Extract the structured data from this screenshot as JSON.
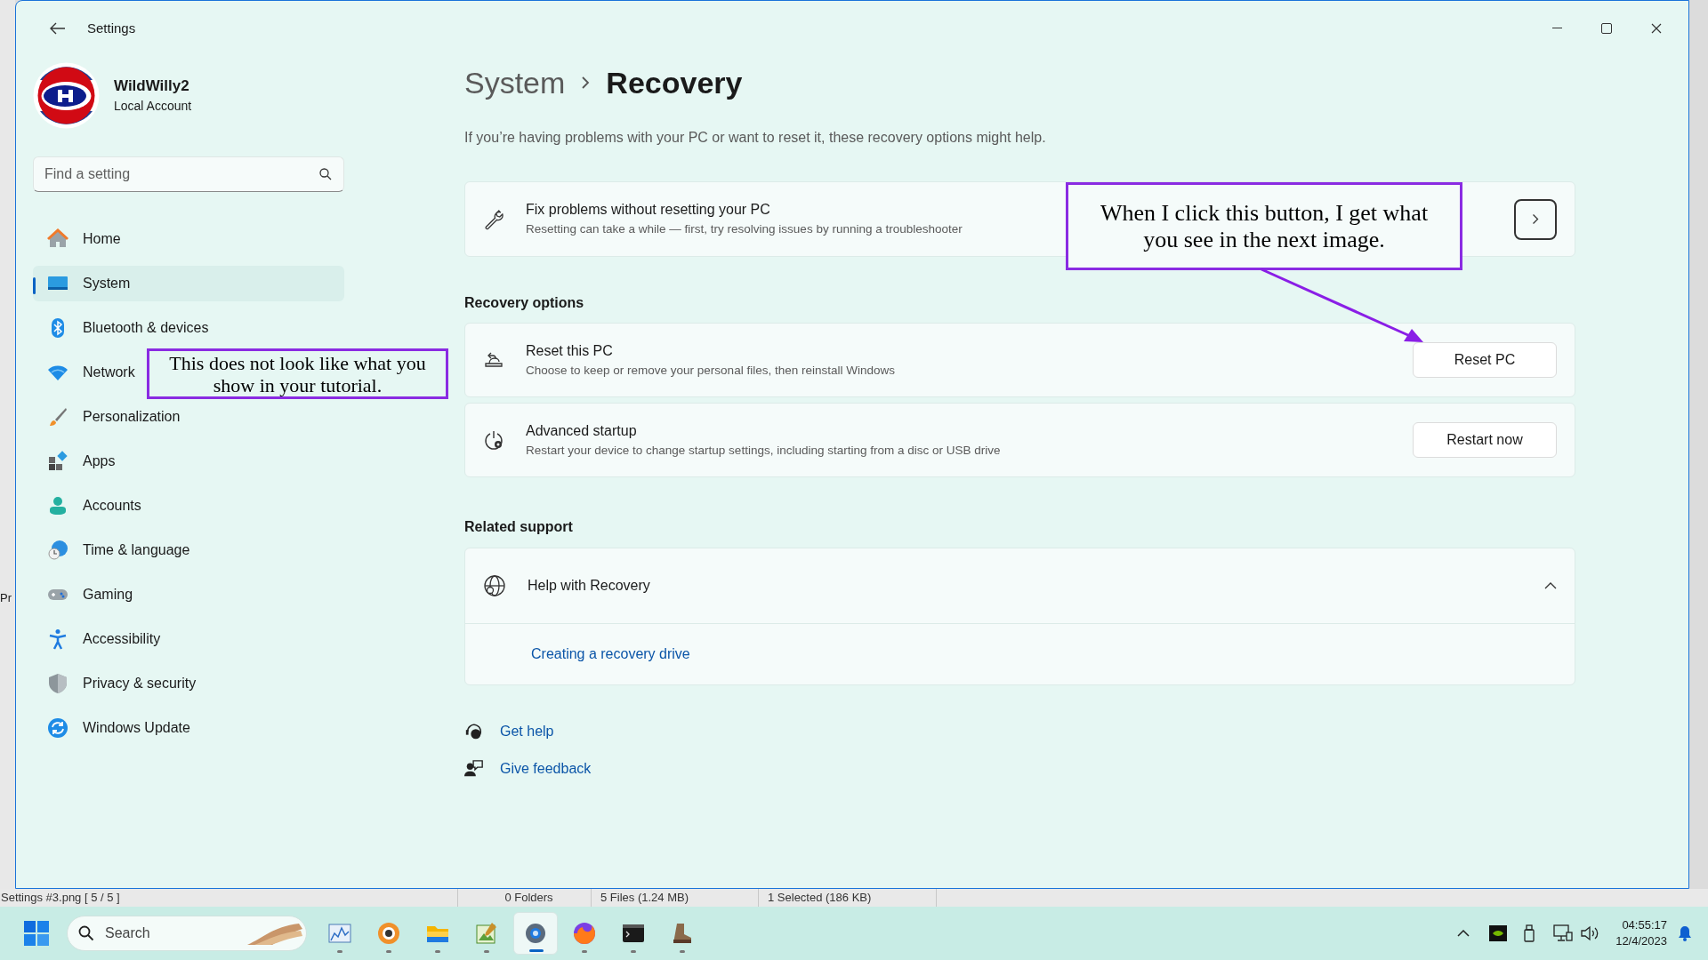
{
  "window": {
    "title": "Settings"
  },
  "profile": {
    "name": "WildWilly2",
    "account_type": "Local Account"
  },
  "search": {
    "placeholder": "Find a setting"
  },
  "sidebar": {
    "items": [
      {
        "kind": "home",
        "label": "Home",
        "selected": false
      },
      {
        "kind": "system",
        "label": "System",
        "selected": true
      },
      {
        "kind": "bluetooth",
        "label": "Bluetooth & devices",
        "selected": false
      },
      {
        "kind": "network",
        "label": "Network",
        "selected": false
      },
      {
        "kind": "personalization",
        "label": "Personalization",
        "selected": false
      },
      {
        "kind": "apps",
        "label": "Apps",
        "selected": false
      },
      {
        "kind": "accounts",
        "label": "Accounts",
        "selected": false
      },
      {
        "kind": "time",
        "label": "Time & language",
        "selected": false
      },
      {
        "kind": "gaming",
        "label": "Gaming",
        "selected": false
      },
      {
        "kind": "accessibility",
        "label": "Accessibility",
        "selected": false
      },
      {
        "kind": "privacy",
        "label": "Privacy & security",
        "selected": false
      },
      {
        "kind": "update",
        "label": "Windows Update",
        "selected": false
      }
    ]
  },
  "breadcrumb": {
    "parent": "System",
    "current": "Recovery"
  },
  "description": "If you’re having problems with your PC or want to reset it, these recovery options might help.",
  "fix_card": {
    "title": "Fix problems without resetting your PC",
    "subtitle": "Resetting can take a while — first, try resolving issues by running a troubleshooter"
  },
  "recovery_options": {
    "heading": "Recovery options",
    "items": [
      {
        "kind": "reset",
        "title": "Reset this PC",
        "subtitle": "Choose to keep or remove your personal files, then reinstall Windows",
        "button": "Reset PC"
      },
      {
        "kind": "startup",
        "title": "Advanced startup",
        "subtitle": "Restart your device to change startup settings, including starting from a disc or USB drive",
        "button": "Restart now"
      }
    ]
  },
  "related_support": {
    "heading": "Related support",
    "help": {
      "title": "Help with Recovery",
      "expanded": true,
      "links": [
        "Creating a recovery drive"
      ]
    }
  },
  "footer_links": [
    {
      "kind": "help",
      "label": "Get help"
    },
    {
      "kind": "feedback",
      "label": "Give feedback"
    }
  ],
  "annotations": [
    {
      "text": "This does not look like what you show in your tutorial."
    },
    {
      "text": "When I click this button, I get what you see in the next image."
    }
  ],
  "background_app": {
    "edge_text": "Pr",
    "status_bar": [
      "Settings #3.png [ 5 / 5 ]",
      "0 Folders",
      "5 Files (1.24 MB)",
      "1 Selected (186 KB)"
    ]
  },
  "taskbar": {
    "search_placeholder": "Search",
    "apps": [
      {
        "kind": "monitor",
        "selected": false
      },
      {
        "kind": "viewer",
        "selected": false
      },
      {
        "kind": "folder",
        "selected": false
      },
      {
        "kind": "editor",
        "selected": false
      },
      {
        "kind": "settings",
        "selected": true
      },
      {
        "kind": "browser",
        "selected": false
      },
      {
        "kind": "terminal",
        "selected": false
      },
      {
        "kind": "tool",
        "selected": false
      }
    ],
    "time": "04:55:17",
    "date": "12/4/2023"
  }
}
